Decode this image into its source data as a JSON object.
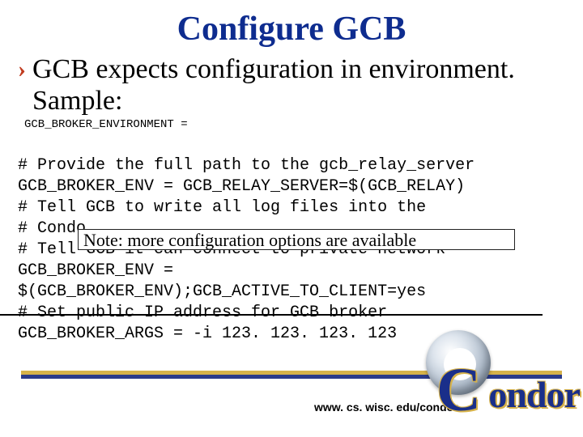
{
  "title": "Configure GCB",
  "bullet": "GCB expects configuration in environment. Sample:",
  "mono_header": "GCB_BROKER_ENVIRONMENT =",
  "code": {
    "l1": "# Provide the full path to the gcb_relay_server",
    "l2": "GCB_BROKER_ENV = GCB_RELAY_SERVER=$(GCB_RELAY)",
    "l3": "# Tell GCB to write all log files into the",
    "l4": "# Condo",
    "l5": "# Tell GCB it can connect to private network",
    "l6": "GCB_BROKER_ENV =",
    "l7": "$(GCB_BROKER_ENV);GCB_ACTIVE_TO_CLIENT=yes",
    "l8": "# Set public IP address for GCB broker",
    "l9": "GCB_BROKER_ARGS = -i 123. 123. 123. 123"
  },
  "note": "Note: more configuration options are available",
  "footer_url": "www. cs. wisc. edu/condor",
  "logo_text": "ondor",
  "logo_c": "C"
}
